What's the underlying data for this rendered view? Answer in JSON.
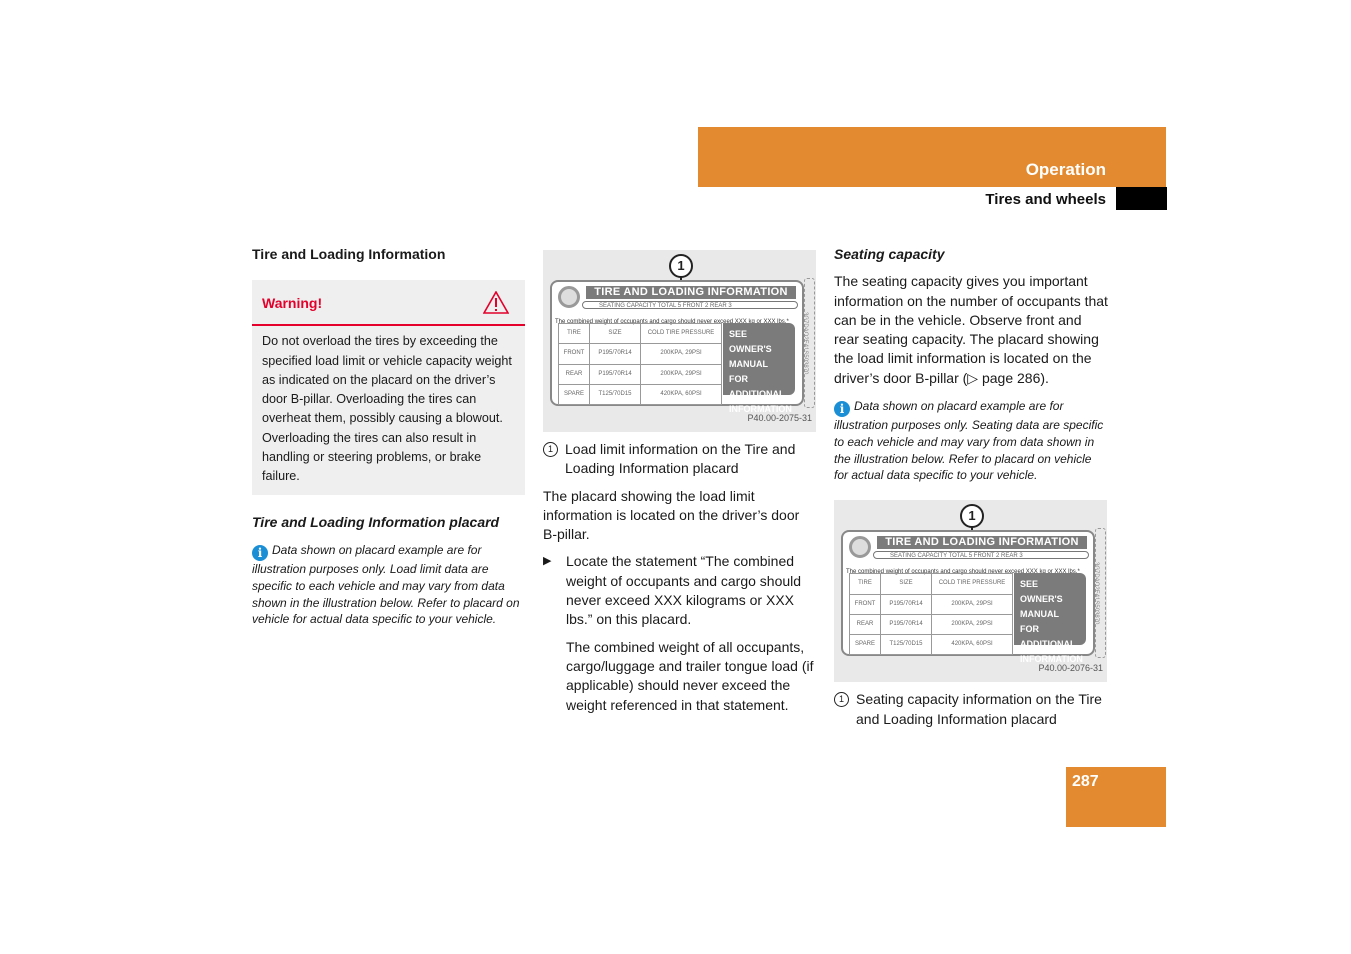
{
  "header": {
    "section": "Operation",
    "subsection": "Tires and wheels",
    "accent_color": "#e38a30"
  },
  "page_number": "287",
  "col1": {
    "heading": "Tire and Loading Information",
    "warning": {
      "title": "Warning!",
      "icon": "warning-triangle-icon",
      "body": "Do not overload the tires by exceeding the specified load limit or vehicle capacity weight as indicated on the placard on the driver’s door B-pillar. Overloading the tires can overheat them, possibly causing a blowout. Overloading the tires can also result in handling or steering problems, or brake failure."
    },
    "subheading": "Tire and Loading Information placard",
    "info": "Data shown on placard example are for illustration purposes only. Load limit data are specific to each vehicle and may vary from data shown in the illustration below. Refer to placard on vehicle for actual data specific to your vehicle."
  },
  "placard": {
    "callout": "1",
    "title": "TIRE AND LOADING INFORMATION",
    "seating": "SEATING CAPACITY   TOTAL 5   FRONT 2   REAR 3",
    "combined": "The combined weight of occupants and cargo should never exceed XXX kg or XXX lbs.*",
    "table": {
      "headers": [
        "TIRE",
        "SIZE",
        "COLD TIRE PRESSURE"
      ],
      "rows": [
        [
          "FRONT",
          "P195/70R14",
          "200KPA, 29PSI"
        ],
        [
          "REAR",
          "P195/70R14",
          "200KPA, 29PSI"
        ],
        [
          "SPARE",
          "T125/70D15",
          "420KPA, 60PSI"
        ]
      ]
    },
    "see_owners": "SEE OWNER'S MANUAL FOR ADDITIONAL INFORMATION",
    "side_code": "3G7DAO2E41S503870"
  },
  "col2": {
    "figure_code": "P40.00-2075-31",
    "legend": {
      "num": "1",
      "text": "Load limit information on the Tire and Loading Information placard"
    },
    "para": "The placard showing the load limit information is located on the driver’s door B-pillar.",
    "step": "Locate the statement “The combined weight of occupants and cargo should never exceed XXX kilograms or XXX lbs.” on this placard.",
    "step_note": "The combined weight of all occupants, cargo/luggage and trailer tongue load (if applicable) should never exceed the weight referenced in that statement."
  },
  "col3": {
    "heading": "Seating capacity",
    "para": "The seating capacity gives you important information on the number of occupants that can be in the vehicle. Observe front and rear seating capacity. The placard showing the load limit information is located on the driver’s door B-pillar (▷ page 286).",
    "info": "Data shown on placard example are for illustration purposes only. Seating data are specific to each vehicle and may vary from data shown in the illustration below. Refer to placard on vehicle for actual data specific to your vehicle.",
    "figure_code": "P40.00-2076-31",
    "legend": {
      "num": "1",
      "text": "Seating capacity information on the Tire and Loading Information placard"
    }
  }
}
